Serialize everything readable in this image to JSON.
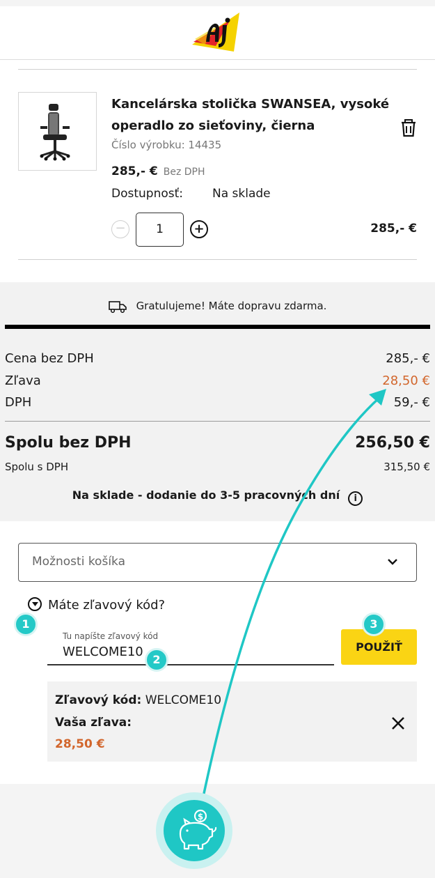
{
  "product": {
    "title": "Kancelárska stolička SWANSEA, vysoké operadlo zo sieťoviny, čierna",
    "sku": "Číslo výrobku: 14435",
    "price": "285,- €",
    "price_vat_note": "Bez DPH",
    "availability_label": "Dostupnosť:",
    "availability_value": "Na sklade",
    "quantity": "1",
    "line_total": "285,- €"
  },
  "summary": {
    "shipping_message": "Gratulujeme! Máte dopravu zdarma.",
    "rows": [
      {
        "label": "Cena bez DPH",
        "value": "285,- €"
      },
      {
        "label": "Zľava",
        "value": "28,50 €"
      },
      {
        "label": "DPH",
        "value": "59,- €"
      }
    ],
    "total_label": "Spolu bez DPH",
    "total_value": "256,50 €",
    "total_vat_label": "Spolu s DPH",
    "total_vat_value": "315,50 €",
    "delivery": "Na sklade - dodanie do 3-5 pracovných dní",
    "info_glyph": "i"
  },
  "cart_options": {
    "label": "Možnosti košíka"
  },
  "discount": {
    "toggle_label": "Máte zľavový kód?",
    "field_label": "Tu napíšte zľavový kód",
    "field_value": "WELCOME10",
    "apply_label": "POUŽIŤ",
    "applied_code_label": "Zľavový kód:",
    "applied_code_value": "WELCOME10",
    "your_discount_label": "Vaša zľava:",
    "your_discount_value": "28,50 €"
  },
  "step_badges": [
    "1",
    "2",
    "3"
  ],
  "icons": [
    "logo",
    "trash-icon",
    "truck-icon",
    "chevron-down-icon",
    "info-icon",
    "close-icon",
    "piggy-bank-icon"
  ],
  "colors": {
    "accent_yellow": "#fad414",
    "discount_orange": "#d2662c",
    "teal": "#1fc7c5"
  }
}
